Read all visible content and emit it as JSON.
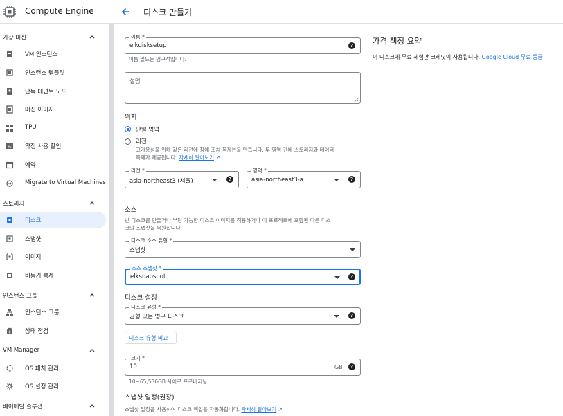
{
  "app": {
    "title": "Compute Engine"
  },
  "sidebar": {
    "sections": [
      {
        "label": "가상 머신",
        "items": [
          {
            "label": "VM 인스턴스",
            "icon": "vm-instance-icon"
          },
          {
            "label": "인스턴스 템플릿",
            "icon": "template-icon"
          },
          {
            "label": "단독 테넌트 노드",
            "icon": "sole-tenant-icon"
          },
          {
            "label": "머신 이미지",
            "icon": "machine-image-icon"
          },
          {
            "label": "TPU",
            "icon": "tpu-icon"
          },
          {
            "label": "약정 사용 할인",
            "icon": "discount-icon"
          },
          {
            "label": "예약",
            "icon": "calendar-icon"
          },
          {
            "label": "Migrate to Virtual Machines",
            "icon": "migrate-icon"
          }
        ]
      },
      {
        "label": "스토리지",
        "items": [
          {
            "label": "디스크",
            "icon": "disk-icon",
            "active": true
          },
          {
            "label": "스냅샷",
            "icon": "snapshot-icon"
          },
          {
            "label": "이미지",
            "icon": "image-icon"
          },
          {
            "label": "비동기 복제",
            "icon": "async-replication-icon"
          }
        ]
      },
      {
        "label": "인스턴스 그룹",
        "items": [
          {
            "label": "인스턴스 그룹",
            "icon": "instance-group-icon"
          },
          {
            "label": "상태 점검",
            "icon": "health-check-icon"
          }
        ]
      },
      {
        "label": "VM Manager",
        "items": [
          {
            "label": "OS 패치 관리",
            "icon": "patch-icon"
          },
          {
            "label": "OS 설정 관리",
            "icon": "gear-icon"
          }
        ]
      },
      {
        "label": "베어메탈 솔루션",
        "items": []
      }
    ]
  },
  "header": {
    "back_icon": "arrow-back-icon",
    "title": "디스크 만들기"
  },
  "form": {
    "name": {
      "label": "이름 *",
      "value": "elkdisksetup",
      "hint": "이름 필드는 영구적입니다."
    },
    "description": {
      "placeholder": "설명"
    },
    "location": {
      "heading": "위치",
      "options": [
        {
          "label": "단일 영역",
          "selected": true
        },
        {
          "label": "리전",
          "selected": false
        }
      ],
      "regional_hint_line1": "고가용성을 위해 같은 리전에 장애 조치 복제본을 만듭니다. 두 영역 간에 스토리지와 데이터",
      "regional_hint_line2": "복제가 제공됩니다.",
      "learn_more": "자세히 알아보기"
    },
    "region": {
      "label": "리전 *",
      "value": "asia-northeast3 (서울)"
    },
    "zone": {
      "label": "영역 *",
      "value": "asia-northeast3-a"
    },
    "source": {
      "heading": "소스",
      "hint_line1": "빈 디스크를 만들거나 부팅 가능한 디스크 이미지를 적용하거나 이 프로젝트에 포함된 다른 디스",
      "hint_line2": "크의 스냅샷을 복원합니다.",
      "type": {
        "label": "디스크 소스 유형 *",
        "value": "스냅샷"
      },
      "snapshot": {
        "label": "소스 스냅샷 *",
        "value": "elksnapshot"
      }
    },
    "disk_settings": {
      "heading": "디스크 설정",
      "type": {
        "label": "디스크 유형 *",
        "value": "균형 있는 영구 디스크"
      },
      "compare_button": "디스크 유형 비교",
      "size": {
        "label": "크기 *",
        "value": "10",
        "unit": "GB",
        "hint": "10~65,536GB 사이로 프로비저닝"
      }
    },
    "snapshot_schedule": {
      "heading": "스냅샷 일정(권장)",
      "hint": "스냅샷 일정을 사용하여 디스크 백업을 자동화합니다.",
      "learn_more": "자세히 알아보기"
    }
  },
  "pricing": {
    "heading": "가격 책정 요약",
    "text": "이 디스크에 무료 체험판 크레딧이 사용됩니다.",
    "link": "Google Cloud 무료 등급"
  },
  "colors": {
    "accent": "#1a73e8",
    "active_bg": "#e8f0fe",
    "text": "#202124",
    "muted": "#5f6368"
  }
}
